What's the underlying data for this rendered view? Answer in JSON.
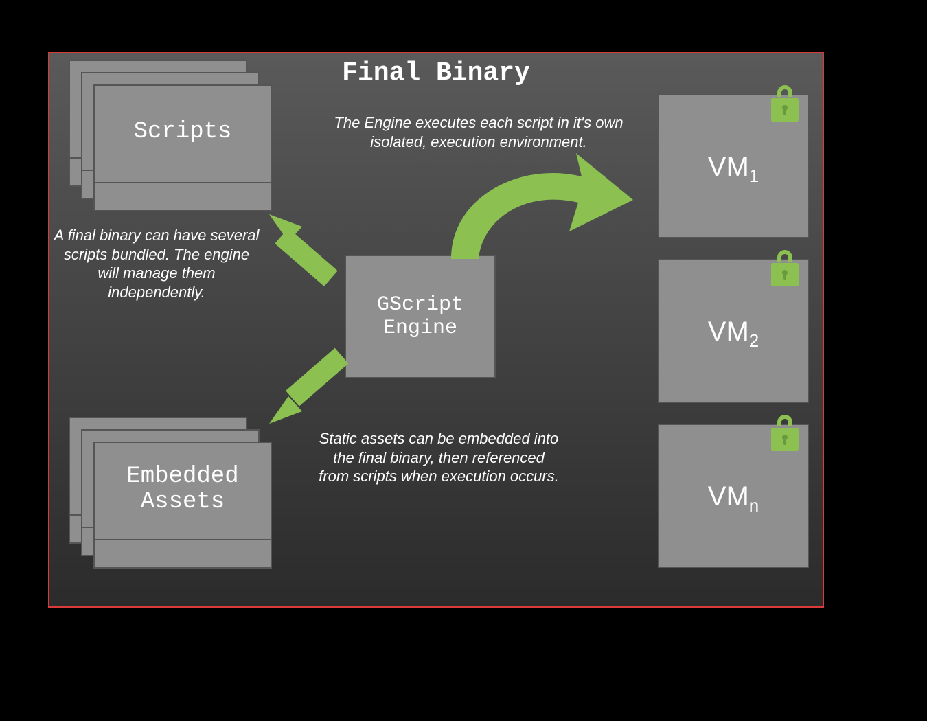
{
  "title": "Final Binary",
  "captions": {
    "engine": "The Engine executes each script in it's own isolated, execution environment.",
    "scripts": "A final binary can have several scripts bundled. The engine will manage them independently.",
    "assets": "Static assets can be embedded into the final binary, then referenced from scripts when execution occurs."
  },
  "boxes": {
    "scripts": "Scripts",
    "assets_line1": "Embedded",
    "assets_line2": "Assets",
    "engine_line1": "GScript",
    "engine_line2": "Engine"
  },
  "vms": {
    "vm1_base": "VM",
    "vm1_sub": "1",
    "vm2_base": "VM",
    "vm2_sub": "2",
    "vm3_base": "VM",
    "vm3_sub": "n"
  },
  "colors": {
    "accent": "#8cc152",
    "frame_border": "#d93a3a",
    "box_fill": "#8f8f8f"
  }
}
